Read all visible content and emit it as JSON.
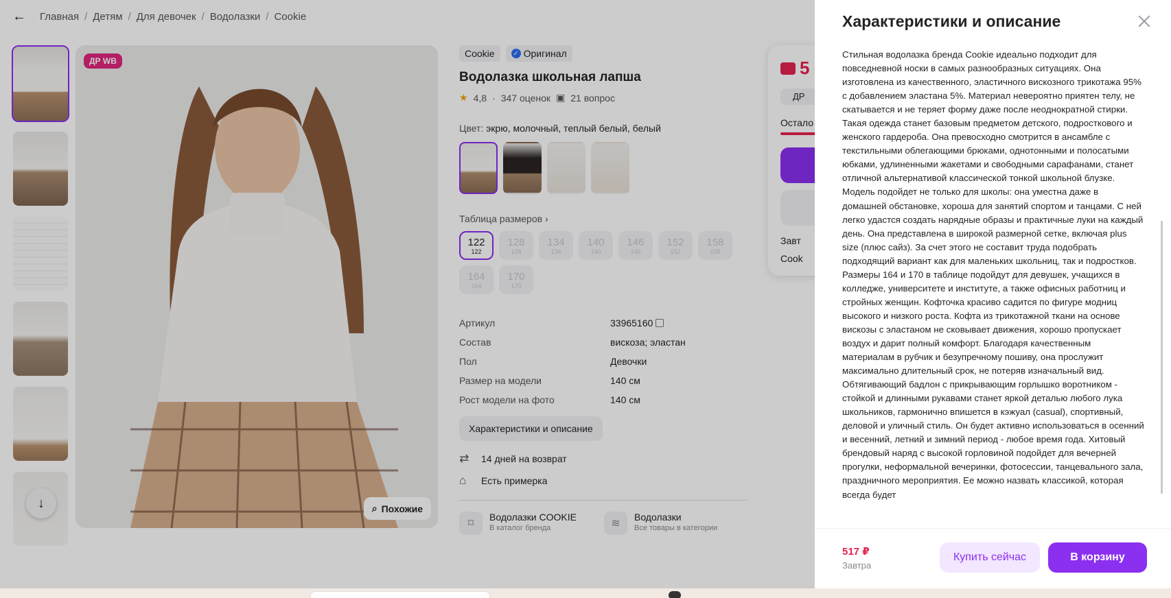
{
  "breadcrumbs": [
    "Главная",
    "Детям",
    "Для девочек",
    "Водолазки",
    "Cookie"
  ],
  "product": {
    "badge": "ДР WB",
    "similar_label": "Похожие",
    "brand_tag": "Cookie",
    "original_tag": "Оригинал",
    "title": "Водолазка школьная лапша",
    "rating": "4,8",
    "reviews": "347 оценок",
    "questions": "21 вопрос",
    "color_label": "Цвет:",
    "color_value": "экрю, молочный, теплый белый, белый",
    "size_table_label": "Таблица размеров",
    "sizes": [
      {
        "main": "122",
        "sub": "122"
      },
      {
        "main": "128",
        "sub": "128"
      },
      {
        "main": "134",
        "sub": "134"
      },
      {
        "main": "140",
        "sub": "140"
      },
      {
        "main": "146",
        "sub": "146"
      },
      {
        "main": "152",
        "sub": "152"
      },
      {
        "main": "158",
        "sub": "158"
      },
      {
        "main": "164",
        "sub": "164"
      },
      {
        "main": "170",
        "sub": "170"
      }
    ],
    "specs": [
      {
        "key": "Артикул",
        "value": "33965160"
      },
      {
        "key": "Состав",
        "value": "вискоза; эластан"
      },
      {
        "key": "Пол",
        "value": "Девочки"
      },
      {
        "key": "Размер на модели",
        "value": "140 см"
      },
      {
        "key": "Рост модели на фото",
        "value": "140 см"
      }
    ],
    "description_button": "Характеристики и описание",
    "return_policy": "14 дней на возврат",
    "fitting": "Есть примерка",
    "brand_link_title": "Водолазки COOKIE",
    "brand_link_sub": "В каталог бренда",
    "category_link_title": "Водолазки",
    "category_link_sub": "Все товары в категории"
  },
  "buy_card": {
    "price_partial": "5",
    "badge_partial": "ДР",
    "remaining_partial": "Остало",
    "delivery_partial": "Завт",
    "seller_partial": "Cook"
  },
  "drawer": {
    "title": "Характеристики и описание",
    "description": "Стильная водолазка бренда Cookie идеально подходит для повседневной носки в самых разнообразных ситуациях. Она изготовлена из качественного, эластичного вискозного трикотажа 95% с добавлением эластана 5%. Материал невероятно приятен телу, не скатывается и не теряет форму даже после неоднократной стирки. Такая одежда станет базовым предметом детского, подросткового и женского гардероба. Она превосходно смотрится в ансамбле с текстильными облегающими брюками, однотонными и полосатыми юбками, удлиненными жакетами и свободными сарафанами, станет отличной альтернативой классической тонкой школьной блузке. Модель подойдет не только для школы: она уместна даже в домашней обстановке, хороша для занятий спортом и танцами. С ней легко удастся создать нарядные образы и практичные луки на каждый день. Она представлена в широкой размерной сетке, включая plus size (плюс сайз). За счет этого не составит труда подобрать подходящий вариант как для маленьких школьниц, так и подростков. Размеры 164 и 170 в таблице подойдут для девушек, учащихся в колледже, университете и институте, а также офисных работниц и стройных женщин. Кофточка красиво садится по фигуре модниц высокого и низкого роста. Кофта из трикотажной ткани на основе вискозы с эластаном не сковывает движения, хорошо пропускает воздух и дарит полный комфорт. Благодаря качественным материалам в рубчик и безупречному пошиву, она прослужит максимально длительный срок, не потеряв изначальный вид. Обтягивающий бадлон с прикрывающим горлышко воротником - стойкой и длинными рукавами станет яркой деталью любого лука школьников, гармонично впишется в кэжуал (casual), спортивный, деловой и уличный стиль. Он будет активно использоваться в осенний и весенний, летний и зимний период - любое время года. Хитовый брендовый наряд с высокой горловиной подойдет для вечерней прогулки, неформальной вечеринки, фотосессии, танцевального зала, праздничного мероприятия. Ее можно назвать классикой, которая всегда будет",
    "price": "517 ₽",
    "delivery": "Завтра",
    "buy_now": "Купить сейчас",
    "add_to_cart": "В корзину"
  },
  "colors": {
    "accent": "#8b2ff0",
    "price": "#e5224f",
    "badge": "#e0267f"
  }
}
